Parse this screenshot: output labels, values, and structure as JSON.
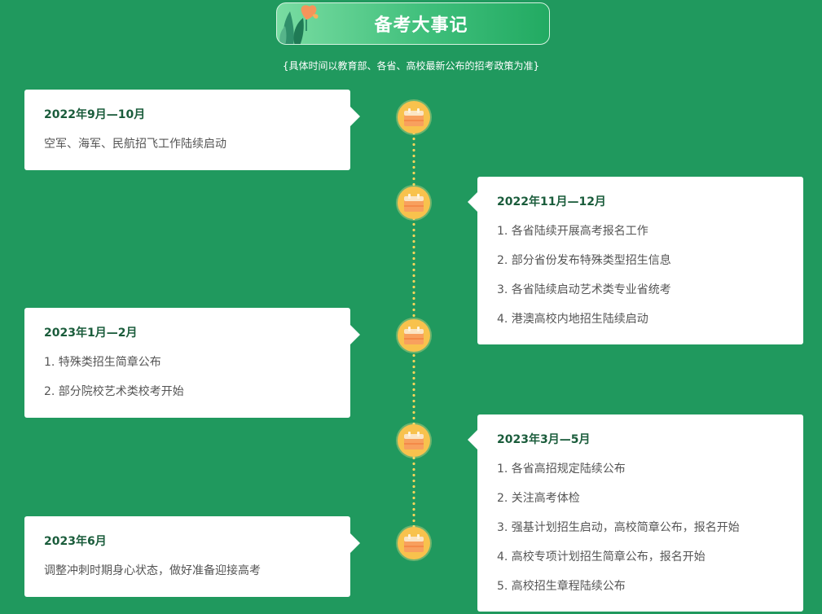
{
  "header": {
    "title": "备考大事记",
    "subtitle": "{具体时间以教育部、各省、高校最新公布的招考政策为准}"
  },
  "timeline": [
    {
      "date": "2022年9月—10月",
      "items": [
        "空军、海军、民航招飞工作陆续启动"
      ]
    },
    {
      "date": "2022年11月—12月",
      "items": [
        "1. 各省陆续开展高考报名工作",
        "2. 部分省份发布特殊类型招生信息",
        "3. 各省陆续启动艺术类专业省统考",
        "4. 港澳高校内地招生陆续启动"
      ]
    },
    {
      "date": "2023年1月—2月",
      "items": [
        "1. 特殊类招生简章公布",
        "2. 部分院校艺术类校考开始"
      ]
    },
    {
      "date": "2023年3月—5月",
      "items": [
        "1. 各省高招规定陆续公布",
        "2. 关注高考体检",
        "3. 强基计划招生启动，高校简章公布，报名开始",
        "4. 高校专项计划招生简章公布，报名开始",
        "5. 高校招生章程陆续公布"
      ]
    },
    {
      "date": "2023年6月",
      "items": [
        "调整冲刺时期身心状态，做好准备迎接高考"
      ]
    }
  ],
  "icons": {
    "node": "calendar-icon",
    "title_decoration": "plant-icon"
  },
  "colors": {
    "background": "#20995e",
    "date_text": "#1a5c3b",
    "node": "#f8c24d",
    "line_dots": "#f7d45a"
  }
}
